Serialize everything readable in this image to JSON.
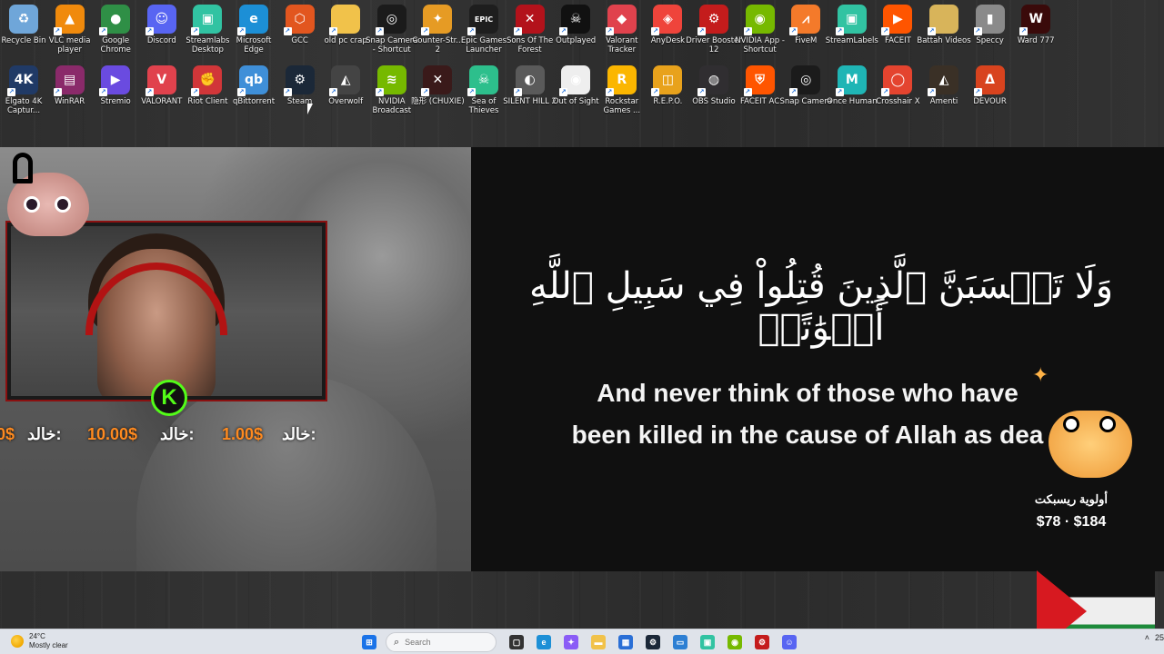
{
  "desktop": {
    "row1": [
      {
        "label": "Recycle Bin",
        "icon": "recycle-bin-icon",
        "color": "#6fa6d9",
        "glyph": "♻"
      },
      {
        "label": "VLC media player",
        "icon": "vlc-icon",
        "color": "#f08a0c",
        "glyph": "▲"
      },
      {
        "label": "Google Chrome",
        "icon": "chrome-icon",
        "color": "#2f8f46",
        "glyph": "●"
      },
      {
        "label": "Discord",
        "icon": "discord-icon",
        "color": "#5865f2",
        "glyph": "☺"
      },
      {
        "label": "Streamlabs Desktop",
        "icon": "streamlabs-icon",
        "color": "#31c3a2",
        "glyph": "▣"
      },
      {
        "label": "Microsoft Edge",
        "icon": "edge-icon",
        "color": "#1c8fd6",
        "glyph": "e"
      },
      {
        "label": "GCC",
        "icon": "gcc-icon",
        "color": "#e2561f",
        "glyph": "⬡"
      },
      {
        "label": "old pc crap",
        "icon": "folder-icon",
        "color": "#f1c24a",
        "glyph": ""
      },
      {
        "label": "Snap Camera - Shortcut",
        "icon": "snap-camera-icon",
        "color": "#1b1b1b",
        "glyph": "◎"
      },
      {
        "label": "Counter-Str... 2",
        "icon": "counter-strike-icon",
        "color": "#e69b24",
        "glyph": "✦"
      },
      {
        "label": "Epic Games Launcher",
        "icon": "epic-games-icon",
        "color": "#1e1e1e",
        "glyph": "EPIC"
      },
      {
        "label": "Sons Of The Forest",
        "icon": "sons-of-the-forest-icon",
        "color": "#b3121b",
        "glyph": "✕"
      },
      {
        "label": "Outplayed",
        "icon": "outplayed-icon",
        "color": "#111",
        "glyph": "☠"
      },
      {
        "label": "Valorant Tracker",
        "icon": "valorant-tracker-icon",
        "color": "#e0424d",
        "glyph": "◆"
      },
      {
        "label": "AnyDesk",
        "icon": "anydesk-icon",
        "color": "#ef443b",
        "glyph": "◈"
      },
      {
        "label": "Driver Booster 12",
        "icon": "driver-booster-icon",
        "color": "#c41c1c",
        "glyph": "⚙"
      },
      {
        "label": "NVIDIA App - Shortcut",
        "icon": "nvidia-icon",
        "color": "#76b900",
        "glyph": "◉"
      },
      {
        "label": "FiveM",
        "icon": "fivem-icon",
        "color": "#f47a2a",
        "glyph": "⩘"
      },
      {
        "label": "StreamLabels",
        "icon": "streamlabels-icon",
        "color": "#31c3a2",
        "glyph": "▣"
      },
      {
        "label": "FACEIT",
        "icon": "faceit-icon",
        "color": "#ff5500",
        "glyph": "▶"
      },
      {
        "label": "Battah Videos",
        "icon": "folder-icon",
        "color": "#d8b45a",
        "glyph": ""
      },
      {
        "label": "Speccy",
        "icon": "speccy-icon",
        "color": "#8a8a8a",
        "glyph": "▮"
      },
      {
        "label": "Ward 777",
        "icon": "ward-777-icon",
        "color": "#3a0a0a",
        "glyph": "W"
      }
    ],
    "row2": [
      {
        "label": "Elgato 4K Captur...",
        "icon": "elgato-icon",
        "color": "#203a66",
        "glyph": "4K"
      },
      {
        "label": "WinRAR",
        "icon": "winrar-icon",
        "color": "#8a2a6a",
        "glyph": "▤"
      },
      {
        "label": "Stremio",
        "icon": "stremio-icon",
        "color": "#6a4be0",
        "glyph": "▶"
      },
      {
        "label": "VALORANT",
        "icon": "valorant-icon",
        "color": "#e0424d",
        "glyph": "V"
      },
      {
        "label": "Riot Client",
        "icon": "riot-client-icon",
        "color": "#d13639",
        "glyph": "✊"
      },
      {
        "label": "qBittorrent",
        "icon": "qbittorrent-icon",
        "color": "#3f8fd8",
        "glyph": "qb"
      },
      {
        "label": "Steam",
        "icon": "steam-icon",
        "color": "#1b2838",
        "glyph": "⚙"
      },
      {
        "label": "Overwolf",
        "icon": "overwolf-icon",
        "color": "#444",
        "glyph": "◭"
      },
      {
        "label": "NVIDIA Broadcast",
        "icon": "nvidia-broadcast-icon",
        "color": "#76b900",
        "glyph": "≋"
      },
      {
        "label": "隐形 (CHUXIE)",
        "icon": "chuxie-icon",
        "color": "#3a1a1a",
        "glyph": "✕"
      },
      {
        "label": "Sea of Thieves",
        "icon": "sea-of-thieves-icon",
        "color": "#2dbf8c",
        "glyph": "☠"
      },
      {
        "label": "SILENT HILL 2",
        "icon": "silent-hill-icon",
        "color": "#5a5a5a",
        "glyph": "◐"
      },
      {
        "label": "Out of Sight",
        "icon": "out-of-sight-icon",
        "color": "#eee",
        "glyph": "◉"
      },
      {
        "label": "Rockstar Games ...",
        "icon": "rockstar-icon",
        "color": "#fbb600",
        "glyph": "R"
      },
      {
        "label": "R.E.P.O.",
        "icon": "repo-icon",
        "color": "#e8a21c",
        "glyph": "◫"
      },
      {
        "label": "OBS Studio",
        "icon": "obs-icon",
        "color": "#302e31",
        "glyph": "◍"
      },
      {
        "label": "FACEIT AC",
        "icon": "faceit-ac-icon",
        "color": "#ff5500",
        "glyph": "⛨"
      },
      {
        "label": "Snap Camera",
        "icon": "snap-camera-icon",
        "color": "#1b1b1b",
        "glyph": "◎"
      },
      {
        "label": "Once Human",
        "icon": "once-human-icon",
        "color": "#1fb5b5",
        "glyph": "M"
      },
      {
        "label": "Crosshair X",
        "icon": "crosshair-x-icon",
        "color": "#e4442f",
        "glyph": "◯"
      },
      {
        "label": "Amenti",
        "icon": "amenti-icon",
        "color": "#3a3026",
        "glyph": "◭"
      },
      {
        "label": "DEVOUR",
        "icon": "devour-icon",
        "color": "#d8431e",
        "glyph": "ᐃ"
      }
    ]
  },
  "stream": {
    "donations": [
      {
        "amount": "0$",
        "name": "خالد:"
      },
      {
        "amount": "10.00$",
        "name": "خالد:"
      },
      {
        "amount": "1.00$",
        "name": "خالد:"
      }
    ],
    "badge": "K",
    "verse_arabic": "وَلَا تَحۡسَبَنَّ ٱلَّذِينَ قُتِلُواْ فِي سَبِيلِ ٱللَّهِ أَمۡوَٰتًاۚ",
    "verse_translation_line1": "And never think of those who have",
    "verse_translation_line2": "been killed in the cause of Allah as dea",
    "goal_title": "أولوية ريسبكت",
    "goal_amount": "$78 · $184"
  },
  "taskbar": {
    "weather_temp": "24°C",
    "weather_desc": "Mostly clear",
    "search_placeholder": "Search",
    "tray_clock": "25"
  },
  "colors": {
    "accent_orange": "#ff8a1f",
    "kick_green": "#53fc18",
    "frame_red": "#8b1010"
  }
}
